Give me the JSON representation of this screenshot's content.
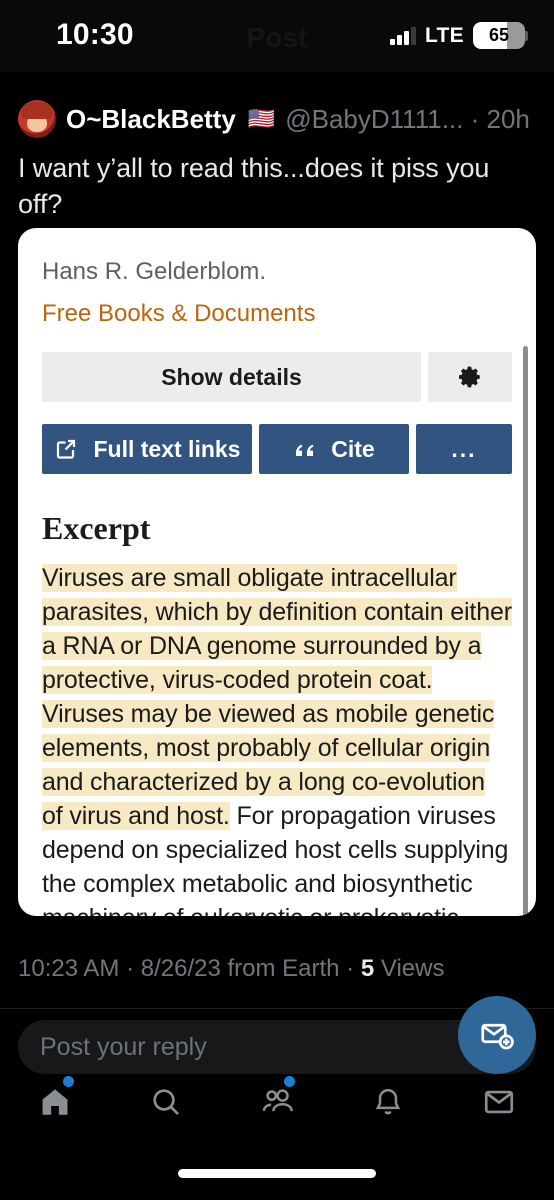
{
  "status_bar": {
    "time": "10:30",
    "ghost_title": "Post",
    "network": "LTE",
    "battery_level": "65",
    "signal_bars_filled": 3,
    "signal_bars_total": 4
  },
  "tweet": {
    "display_name": "O~BlackBetty",
    "flag": "🇺🇸",
    "handle_and_time": "@BabyD1111... · 20h",
    "text": "I want y’all to read this...does it piss you off?"
  },
  "card": {
    "authors": "Hans R. Gelderblom.",
    "publication_type": "Free Books & Documents",
    "buttons": {
      "show_details": "Show details",
      "settings_icon": "gear-icon",
      "full_text_links": "Full text links",
      "full_text_icon": "external-link-icon",
      "cite": "Cite",
      "cite_icon": "quote-icon",
      "more": "..."
    },
    "excerpt_heading": "Excerpt",
    "excerpt_highlighted": "Viruses are small obligate intracellular parasites, which by definition contain either a RNA or DNA genome surrounded by a protective, virus-coded protein coat. Viruses may be viewed as mobile genetic elements, most probably of cellular origin and characterized by a long co-evolution of virus and host.",
    "excerpt_rest": " For propagation viruses depend on specialized host cells supplying the complex metabolic and biosynthetic machinery of eukaryotic or prokaryotic cells. A complete virus particle is called a virion. The main function of the virion is",
    "colors": {
      "highlight": "#f7e9c3",
      "primary_button": "#325480",
      "secondary_button": "#ececec",
      "publication_type": "#b8670f"
    }
  },
  "meta": {
    "time": "10:23 AM",
    "sep1": " · ",
    "date": "8/26/23",
    "source": " from Earth · ",
    "views_count": "5",
    "views_label": " Views"
  },
  "reply": {
    "placeholder": "Post your reply",
    "fab_icon": "new-message-icon"
  },
  "bottom_nav": {
    "items": [
      {
        "name": "home",
        "icon": "home-icon",
        "badge": true
      },
      {
        "name": "search",
        "icon": "search-icon",
        "badge": false
      },
      {
        "name": "communities",
        "icon": "communities-icon",
        "badge": true
      },
      {
        "name": "notifications",
        "icon": "bell-icon",
        "badge": false
      },
      {
        "name": "messages",
        "icon": "envelope-icon",
        "badge": false
      }
    ]
  }
}
